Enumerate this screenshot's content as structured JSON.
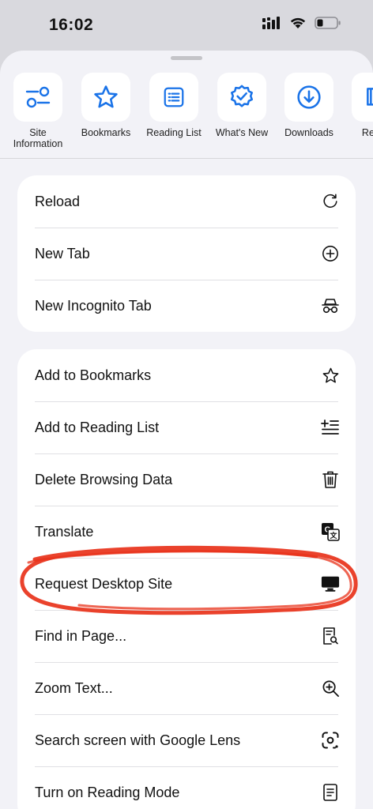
{
  "status": {
    "time": "16:02"
  },
  "shortcuts": [
    {
      "label": "Site\nInformation",
      "icon": "site-information-icon"
    },
    {
      "label": "Bookmarks",
      "icon": "star-icon"
    },
    {
      "label": "Reading List",
      "icon": "reading-list-icon"
    },
    {
      "label": "What's New",
      "icon": "badge-check-icon"
    },
    {
      "label": "Downloads",
      "icon": "download-icon"
    },
    {
      "label": "Recen",
      "icon": "recent-tabs-icon"
    }
  ],
  "menu_group_1": [
    {
      "label": "Reload",
      "icon": "reload-icon"
    },
    {
      "label": "New Tab",
      "icon": "plus-circle-icon"
    },
    {
      "label": "New Incognito Tab",
      "icon": "incognito-icon"
    }
  ],
  "menu_group_2": [
    {
      "label": "Add to Bookmarks",
      "icon": "star-icon"
    },
    {
      "label": "Add to Reading List",
      "icon": "add-reading-list-icon"
    },
    {
      "label": "Delete Browsing Data",
      "icon": "trash-icon"
    },
    {
      "label": "Translate",
      "icon": "translate-icon"
    },
    {
      "label": "Request Desktop Site",
      "icon": "desktop-icon",
      "highlighted": true
    },
    {
      "label": "Find in Page...",
      "icon": "find-in-page-icon"
    },
    {
      "label": "Zoom Text...",
      "icon": "zoom-icon"
    },
    {
      "label": "Search screen with Google Lens",
      "icon": "google-lens-icon"
    },
    {
      "label": "Turn on Reading Mode",
      "icon": "reading-mode-icon"
    }
  ],
  "colors": {
    "accent": "#1a73e8",
    "annotation": "#e8321a",
    "sheet_bg": "#f2f2f7"
  }
}
